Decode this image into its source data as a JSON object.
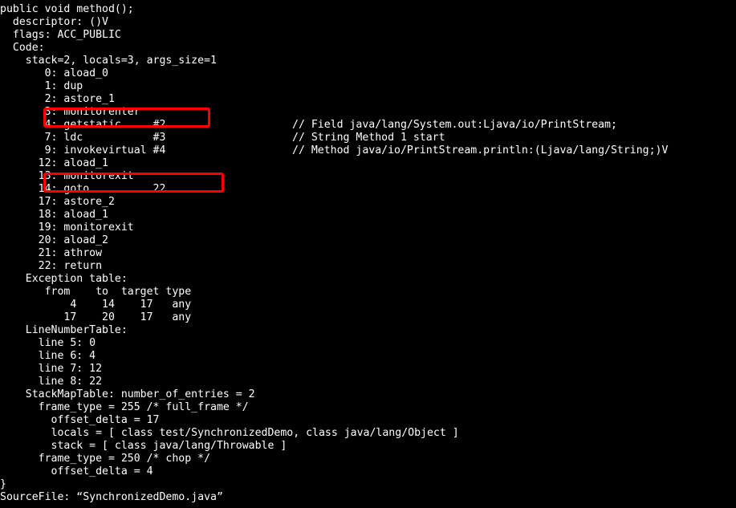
{
  "terminal": {
    "background_color": "#000000",
    "foreground_color": "#ffffff",
    "annotation_color": "#ff0000"
  },
  "listing": {
    "lines": [
      {
        "text": "public void method();"
      },
      {
        "text": "  descriptor: ()V"
      },
      {
        "text": "  flags: ACC_PUBLIC"
      },
      {
        "text": "  Code:"
      },
      {
        "text": "    stack=2, locals=3, args_size=1"
      },
      {
        "text": "       0: aload_0"
      },
      {
        "text": "       1: dup"
      },
      {
        "text": "       2: astore_1"
      },
      {
        "text": "       3: monitorenter"
      },
      {
        "text": "       4: getstatic     #2",
        "comment": "// Field java/lang/System.out:Ljava/io/PrintStream;"
      },
      {
        "text": "       7: ldc           #3",
        "comment": "// String Method 1 start"
      },
      {
        "text": "       9: invokevirtual #4",
        "comment": "// Method java/io/PrintStream.println:(Ljava/lang/String;)V"
      },
      {
        "text": "      12: aload_1"
      },
      {
        "text": "      13: monitorexit"
      },
      {
        "text": "      14: goto          22"
      },
      {
        "text": "      17: astore_2"
      },
      {
        "text": "      18: aload_1"
      },
      {
        "text": "      19: monitorexit"
      },
      {
        "text": "      20: aload_2"
      },
      {
        "text": "      21: athrow"
      },
      {
        "text": "      22: return"
      },
      {
        "text": "    Exception table:"
      },
      {
        "text": "       from    to  target type"
      },
      {
        "text": "           4    14    17   any"
      },
      {
        "text": "          17    20    17   any"
      },
      {
        "text": "    LineNumberTable:"
      },
      {
        "text": "      line 5: 0"
      },
      {
        "text": "      line 6: 4"
      },
      {
        "text": "      line 7: 12"
      },
      {
        "text": "      line 8: 22"
      },
      {
        "text": "    StackMapTable: number_of_entries = 2"
      },
      {
        "text": "      frame_type = 255 /* full_frame */"
      },
      {
        "text": "        offset_delta = 17"
      },
      {
        "text": "        locals = [ class test/SynchronizedDemo, class java/lang/Object ]"
      },
      {
        "text": "        stack = [ class java/lang/Throwable ]"
      },
      {
        "text": "      frame_type = 250 /* chop */"
      },
      {
        "text": "        offset_delta = 4"
      },
      {
        "text": "}"
      },
      {
        "text": "SourceFile: “SynchronizedDemo.java”"
      }
    ]
  },
  "annotations": [
    {
      "id": "annot-monitorenter",
      "target_text": "3: monitorenter",
      "color": "#ff0000"
    },
    {
      "id": "annot-monitorexit",
      "target_text": "13: monitorexit",
      "color": "#ff0000"
    }
  ]
}
